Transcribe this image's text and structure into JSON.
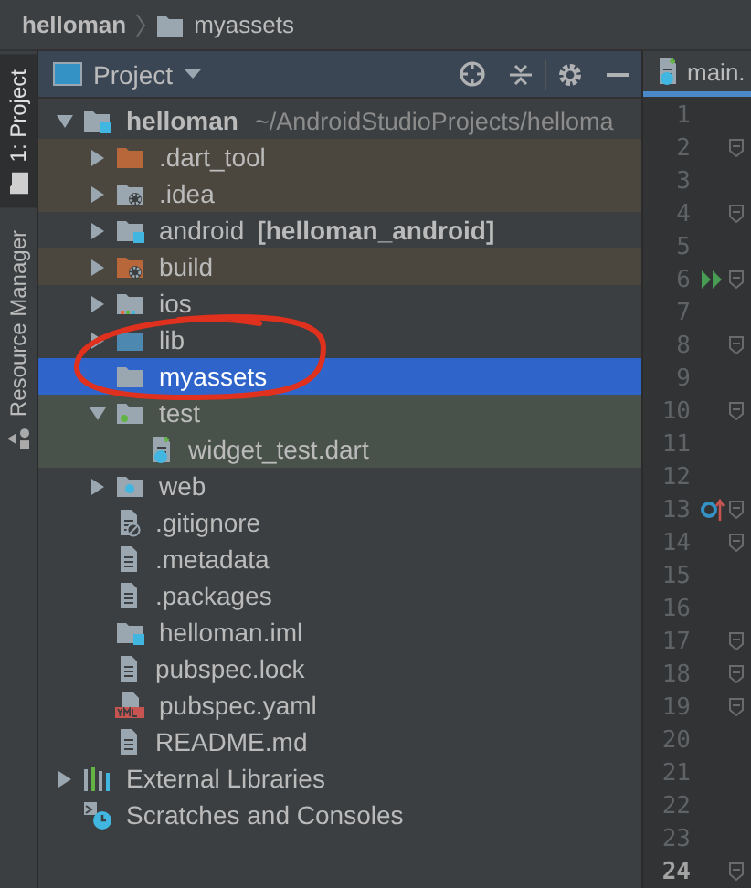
{
  "breadcrumbs": [
    {
      "label": "helloman",
      "kind": "project"
    },
    {
      "label": "myassets",
      "kind": "folder"
    }
  ],
  "tool_strip": [
    {
      "label": "1: Project",
      "kind": "project",
      "selected": true
    },
    {
      "label": "Resource Manager",
      "kind": "resources",
      "selected": false
    }
  ],
  "project_panel": {
    "title": "Project"
  },
  "tree": [
    {
      "label": "helloman",
      "detail": "~/AndroidStudioProjects/helloma",
      "kind": "module",
      "expanded": true,
      "selected": false,
      "children": [
        {
          "label": ".dart_tool",
          "kind": "excluded",
          "excluded": true,
          "expanded": false,
          "selected": false
        },
        {
          "label": ".idea",
          "kind": "config",
          "excluded": true,
          "expanded": false,
          "selected": false
        },
        {
          "label": "android",
          "module_name": "[helloman_android]",
          "kind": "module",
          "expanded": false,
          "selected": false
        },
        {
          "label": "build",
          "kind": "excluded-config",
          "excluded": true,
          "expanded": false,
          "selected": false
        },
        {
          "label": "ios",
          "kind": "ios",
          "expanded": false,
          "selected": false
        },
        {
          "label": "lib",
          "kind": "source",
          "expanded": false,
          "selected": false
        },
        {
          "label": "myassets",
          "kind": "folder",
          "selected": true
        },
        {
          "label": "test",
          "kind": "test",
          "test_source": true,
          "expanded": true,
          "selected": false,
          "children": [
            {
              "label": "widget_test.dart",
              "kind": "dart-test",
              "test_source": true,
              "selected": false
            }
          ]
        },
        {
          "label": "web",
          "kind": "web",
          "expanded": false,
          "selected": false
        },
        {
          "label": ".gitignore",
          "kind": "ignore",
          "selected": false
        },
        {
          "label": ".metadata",
          "kind": "text",
          "selected": false
        },
        {
          "label": ".packages",
          "kind": "text",
          "selected": false
        },
        {
          "label": "helloman.iml",
          "kind": "module",
          "selected": false
        },
        {
          "label": "pubspec.lock",
          "kind": "text",
          "selected": false
        },
        {
          "label": "pubspec.yaml",
          "kind": "yaml",
          "selected": false
        },
        {
          "label": "README.md",
          "kind": "text",
          "selected": false
        }
      ]
    },
    {
      "label": "External Libraries",
      "kind": "libraries",
      "expanded": false,
      "selected": false
    },
    {
      "label": "Scratches and Consoles",
      "kind": "scratches",
      "selected": false
    }
  ],
  "editor": {
    "tab": {
      "label": "main.",
      "selected": true
    },
    "lines": [
      {
        "number": "1",
        "current": false
      },
      {
        "number": "2",
        "current": false,
        "fold": true
      },
      {
        "number": "3",
        "current": false
      },
      {
        "number": "4",
        "current": false,
        "fold": true
      },
      {
        "number": "5",
        "current": false
      },
      {
        "number": "6",
        "current": false,
        "fold": true,
        "run": true
      },
      {
        "number": "7",
        "current": false
      },
      {
        "number": "8",
        "current": false,
        "fold": true
      },
      {
        "number": "9",
        "current": false
      },
      {
        "number": "10",
        "current": false,
        "fold": true
      },
      {
        "number": "11",
        "current": false
      },
      {
        "number": "12",
        "current": false
      },
      {
        "number": "13",
        "current": false,
        "fold": true,
        "override": true
      },
      {
        "number": "14",
        "current": false,
        "fold": true
      },
      {
        "number": "15",
        "current": false
      },
      {
        "number": "16",
        "current": false
      },
      {
        "number": "17",
        "current": false,
        "fold": true
      },
      {
        "number": "18",
        "current": false,
        "fold": true
      },
      {
        "number": "19",
        "current": false,
        "fold": true
      },
      {
        "number": "20",
        "current": false
      },
      {
        "number": "21",
        "current": false
      },
      {
        "number": "22",
        "current": false
      },
      {
        "number": "23",
        "current": false
      },
      {
        "number": "24",
        "current": true,
        "fold": true
      }
    ]
  }
}
